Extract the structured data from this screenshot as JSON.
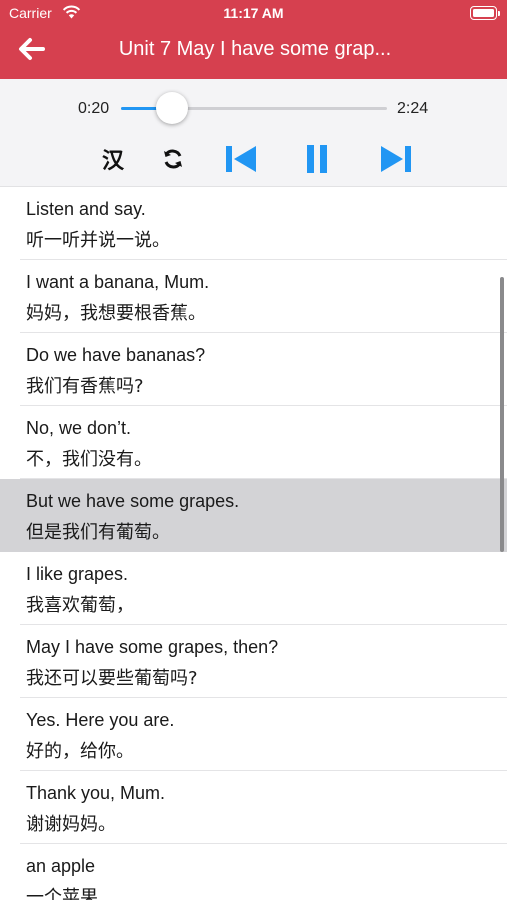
{
  "status_bar": {
    "carrier": "Carrier",
    "time": "11:17 AM"
  },
  "nav": {
    "title": "Unit 7 May I have some grap...",
    "back_icon": "arrow-left-icon"
  },
  "player": {
    "current_time": "0:20",
    "total_time": "2:24",
    "progress_fraction": 0.19,
    "hanzi_toggle": "汉",
    "accent_color": "#2196f3"
  },
  "colors": {
    "header": "#d6404f",
    "selected_row": "#d3d3d6"
  },
  "sentences": [
    {
      "en": "Listen and say.",
      "zh": "听一听并说一说。"
    },
    {
      "en": "I want a banana, Mum.",
      "zh": "妈妈，我想要根香蕉。"
    },
    {
      "en": "Do we have bananas?",
      "zh": "我们有香蕉吗?"
    },
    {
      "en": "No, we don’t.",
      "zh": "不，我们没有。"
    },
    {
      "en": "But we have some grapes.",
      "zh": "但是我们有葡萄。",
      "selected": true
    },
    {
      "en": "I like grapes.",
      "zh": "我喜欢葡萄，"
    },
    {
      "en": "May I have some grapes, then?",
      "zh": "我还可以要些葡萄吗?"
    },
    {
      "en": "Yes. Here you are.",
      "zh": "好的，给你。"
    },
    {
      "en": "Thank you, Mum.",
      "zh": "谢谢妈妈。"
    },
    {
      "en": "an apple",
      "zh": "一个苹果"
    }
  ]
}
